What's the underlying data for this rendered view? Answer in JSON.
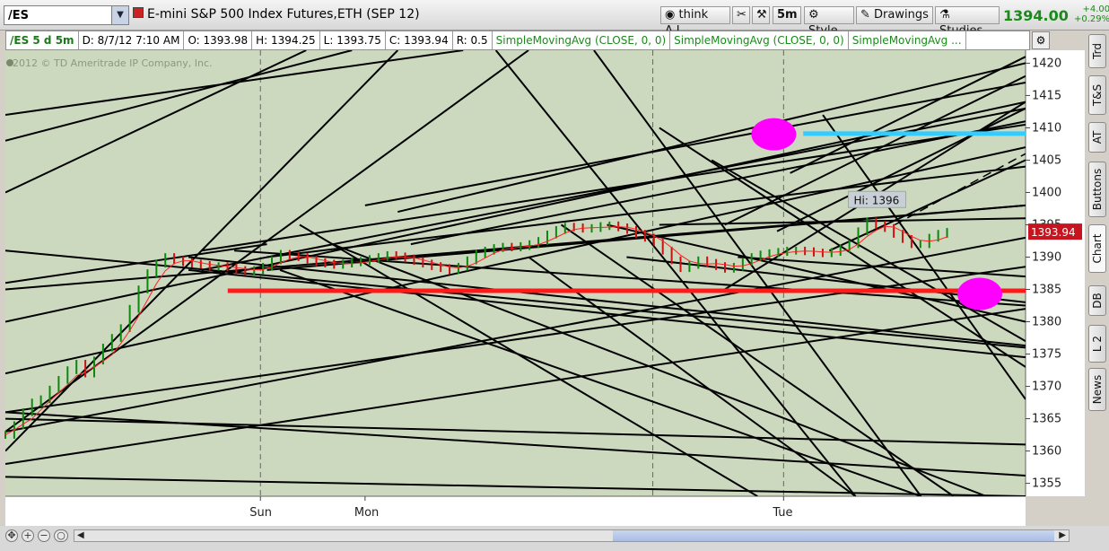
{
  "toolbar": {
    "symbol": "/ES",
    "description": "E-mini S&P 500 Index Futures,ETH (SEP 12)",
    "think_ai": "think A.I.",
    "timeframe": "5m",
    "style": "Style",
    "drawings": "Drawings",
    "studies": "Studies",
    "last_price": "1394.00",
    "change_abs": "+4.00",
    "change_pct": "+0.29%"
  },
  "info_bar": {
    "symbol": "/ES 5 d 5m",
    "date": "D: 8/7/12 7:10 AM",
    "open": "O: 1393.98",
    "high": "H: 1394.25",
    "low": "L: 1393.75",
    "close": "C: 1393.94",
    "range": "R: 0.5",
    "studies": [
      "SimpleMovingAvg (CLOSE, 0, 0)",
      "SimpleMovingAvg (CLOSE, 0, 0)",
      "SimpleMovingAvg ..."
    ]
  },
  "side_tabs": [
    "Trd",
    "T&S",
    "AT",
    "Buttons",
    "Chart",
    "DB",
    "L 2",
    "News"
  ],
  "copyright": "2012 © TD Ameritrade IP Company, Inc.",
  "chart_data": {
    "type": "line",
    "ylim": [
      1353,
      1422
    ],
    "y_ticks": [
      1355,
      1360,
      1365,
      1370,
      1375,
      1380,
      1385,
      1390,
      1395,
      1400,
      1405,
      1410,
      1415,
      1420
    ],
    "x_labels": [
      {
        "label": "Sun",
        "bar": 39
      },
      {
        "label": "Mon",
        "bar": 55
      },
      {
        "label": "Tue",
        "bar": 119
      }
    ],
    "session_separators": [
      39,
      99,
      119
    ],
    "bar_count": 156,
    "series": [
      {
        "values": [
          1362.5,
          1364,
          1366,
          1367.5,
          1368,
          1369.5,
          1371,
          1372.5,
          1373.5,
          1372,
          1374,
          1376,
          1377.5,
          1379,
          1382,
          1385,
          1387.5,
          1389,
          1390,
          1389.5,
          1389.2,
          1389,
          1388.8,
          1388.5,
          1388.6,
          1388.4,
          1388,
          1387.8,
          1388,
          1388.5,
          1389.5,
          1390.5,
          1390.2,
          1390,
          1389.6,
          1389.2,
          1389,
          1388.8,
          1389,
          1389.2,
          1389.4,
          1389.7,
          1390,
          1390.3,
          1390.1,
          1389.8,
          1389.4,
          1389,
          1388.6,
          1388.3,
          1388,
          1388.5,
          1389.5,
          1390.5,
          1391,
          1391.4,
          1391.6,
          1391.5,
          1391.7,
          1392,
          1392.5,
          1393.5,
          1394.2,
          1394.7,
          1394.6,
          1394.4,
          1394.5,
          1394.8,
          1394.9,
          1394.6,
          1394.2,
          1393.6,
          1393,
          1392.4,
          1391,
          1389.5,
          1388.3,
          1388.8,
          1389.5,
          1389.1,
          1388.6,
          1388.2,
          1388.5,
          1389.3,
          1390,
          1390.4,
          1390.6,
          1390.8,
          1391,
          1391,
          1390.9,
          1390.7,
          1390.6,
          1390.8,
          1391.3,
          1392,
          1394,
          1395.5,
          1395,
          1394.5,
          1393.6,
          1392.8,
          1392,
          1392,
          1393,
          1393.6,
          1393.9
        ],
        "ohlc_note": "close path of 5m bars"
      }
    ],
    "annotations": [
      {
        "label": "Hi: 1396",
        "bar": 130,
        "value": 1396
      },
      {
        "label": "1393.94",
        "value": 1393.94,
        "kind": "price_tag"
      }
    ],
    "horizontal_lines": [
      {
        "value": 1384.8,
        "x_start_bar": 34,
        "color": "#ff1a1a"
      },
      {
        "value": 1409.1,
        "x_start_bar": 122,
        "color": "#33ccff"
      }
    ],
    "highlight_ellipses": [
      {
        "bar": 117.5,
        "value": 1409,
        "color": "#ff00ff"
      },
      {
        "bar": 149,
        "value": 1384.3,
        "color": "#ff00ff"
      }
    ],
    "trend_lines": [
      [
        0,
        1363,
        156,
        1393
      ],
      [
        0,
        1366,
        156,
        1388.5
      ],
      [
        0,
        1358,
        156,
        1382
      ],
      [
        0,
        1366,
        156,
        1356.2
      ],
      [
        0,
        1365,
        156,
        1361
      ],
      [
        0,
        1372,
        156,
        1407
      ],
      [
        0,
        1391,
        156,
        1376
      ],
      [
        0,
        1385,
        156,
        1398
      ],
      [
        0,
        1380,
        156,
        1414
      ],
      [
        0,
        1408,
        53,
        1422
      ],
      [
        0,
        1412,
        70,
        1422
      ],
      [
        0,
        1400,
        46,
        1422
      ],
      [
        0,
        1386,
        40,
        1392
      ],
      [
        0,
        1360,
        60,
        1422
      ],
      [
        0,
        1363,
        80,
        1422
      ],
      [
        0,
        1356,
        156,
        1353
      ],
      [
        28,
        1388,
        156,
        1374.5
      ],
      [
        28,
        1390,
        156,
        1376.3
      ],
      [
        35,
        1391,
        156,
        1382.5
      ],
      [
        30,
        1391,
        156,
        1410.5
      ],
      [
        30,
        1388,
        156,
        1413
      ],
      [
        40,
        1390,
        156,
        1404
      ],
      [
        40,
        1388,
        156,
        1398
      ],
      [
        42,
        1388,
        140,
        1353
      ],
      [
        45,
        1395,
        115,
        1353
      ],
      [
        50,
        1392,
        150,
        1353
      ],
      [
        60,
        1397,
        156,
        1420
      ],
      [
        62,
        1392,
        156,
        1411
      ],
      [
        55,
        1398,
        156,
        1417
      ],
      [
        80,
        1390,
        130,
        1353
      ],
      [
        85,
        1395,
        145,
        1353
      ],
      [
        95,
        1390,
        156,
        1383
      ],
      [
        92,
        1395,
        156,
        1380
      ],
      [
        100,
        1395,
        156,
        1396
      ],
      [
        112,
        1390,
        156,
        1387
      ],
      [
        110,
        1385,
        156,
        1414
      ],
      [
        110,
        1395,
        156,
        1418
      ],
      [
        118,
        1394,
        156,
        1413
      ],
      [
        120,
        1403,
        156,
        1421
      ],
      [
        126,
        1391,
        156,
        1405
      ],
      [
        108,
        1405,
        156,
        1377
      ],
      [
        100,
        1410,
        156,
        1373
      ],
      [
        125,
        1412,
        156,
        1368
      ],
      [
        90,
        1422,
        140,
        1353
      ],
      [
        75,
        1422,
        130,
        1353
      ]
    ],
    "dashed_line": [
      136,
      1395,
      156,
      1406
    ]
  }
}
